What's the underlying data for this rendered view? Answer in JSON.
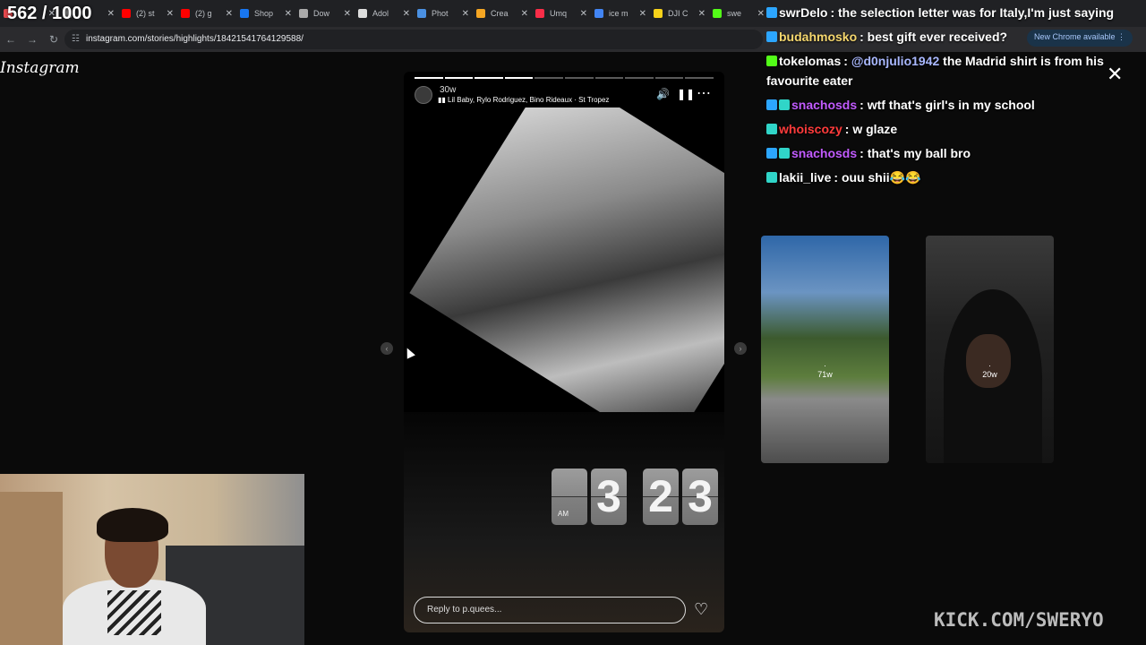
{
  "overlay_counter": "562 / 1000",
  "browser": {
    "tabs": [
      {
        "label": "",
        "color": "#e5484d"
      },
      {
        "label": "",
        "color": "#888888"
      },
      {
        "label": "(2) st",
        "color": "#ff0000"
      },
      {
        "label": "(2) g",
        "color": "#ff0000"
      },
      {
        "label": "Shop",
        "color": "#1877f2"
      },
      {
        "label": "Dow",
        "color": "#aaaaaa"
      },
      {
        "label": "Adol",
        "color": "#dddddd"
      },
      {
        "label": "Phot",
        "color": "#4a90e2"
      },
      {
        "label": "Crea",
        "color": "#f5a623"
      },
      {
        "label": "Umq",
        "color": "#fa2d48"
      },
      {
        "label": "ice m",
        "color": "#4285f4"
      },
      {
        "label": "DJI C",
        "color": "#f7d21a"
      },
      {
        "label": "swe",
        "color": "#53fc18"
      }
    ],
    "url": "instagram.com/stories/highlights/18421541764129588/",
    "update_badge": "New Chrome available"
  },
  "instagram": {
    "logo": "Instagram",
    "story": {
      "age": "30w",
      "song": "Lil Baby, Rylo Rodriguez, Bino Rideaux · St Tropez",
      "progress_total": 10,
      "progress_done": 4,
      "clock_am": "AM",
      "clock_digits": [
        "3",
        "2",
        "3"
      ],
      "reply_placeholder": "Reply to p.quees..."
    },
    "thumbnails": [
      {
        "age": "71w"
      },
      {
        "age": "20w"
      }
    ]
  },
  "chat": [
    {
      "user": "swrDelo",
      "text": ": the selection letter was for Italy,I'm just saying",
      "color": "#ffffff",
      "badges": [
        "#2ca6ff"
      ]
    },
    {
      "user": "budahmosko",
      "text": ": best gift ever received?",
      "color": "#f5d76e",
      "badges": [
        "#2ca6ff"
      ]
    },
    {
      "user": "tokelomas",
      "text": ": @d0njulio1942 the Madrid shirt is from his favourite eater",
      "mention": "@d0njulio1942",
      "color": "#ffffff",
      "badges": [
        "#53fc18"
      ]
    },
    {
      "user": "snachosds",
      "text": ": wtf that's girl's in my school",
      "color": "#c25bff",
      "badges": [
        "#2ca6ff",
        "#30d5c8"
      ]
    },
    {
      "user": "whoiscozy",
      "text": ": w glaze",
      "color": "#ff3b3b",
      "badges": [
        "#30d5c8"
      ]
    },
    {
      "user": "snachosds",
      "text": ": that's my ball bro",
      "color": "#c25bff",
      "badges": [
        "#2ca6ff",
        "#30d5c8"
      ]
    },
    {
      "user": "lakii_live",
      "text": ": ouu shii😂😂",
      "color": "#ffffff",
      "badges": [
        "#30d5c8"
      ]
    }
  ],
  "watermark": "KICK.COM/SWERYO",
  "icons": [
    "mute-icon",
    "pause-icon",
    "more-icon",
    "heart-icon",
    "close-icon",
    "chevron-left-icon",
    "chevron-right-icon"
  ]
}
